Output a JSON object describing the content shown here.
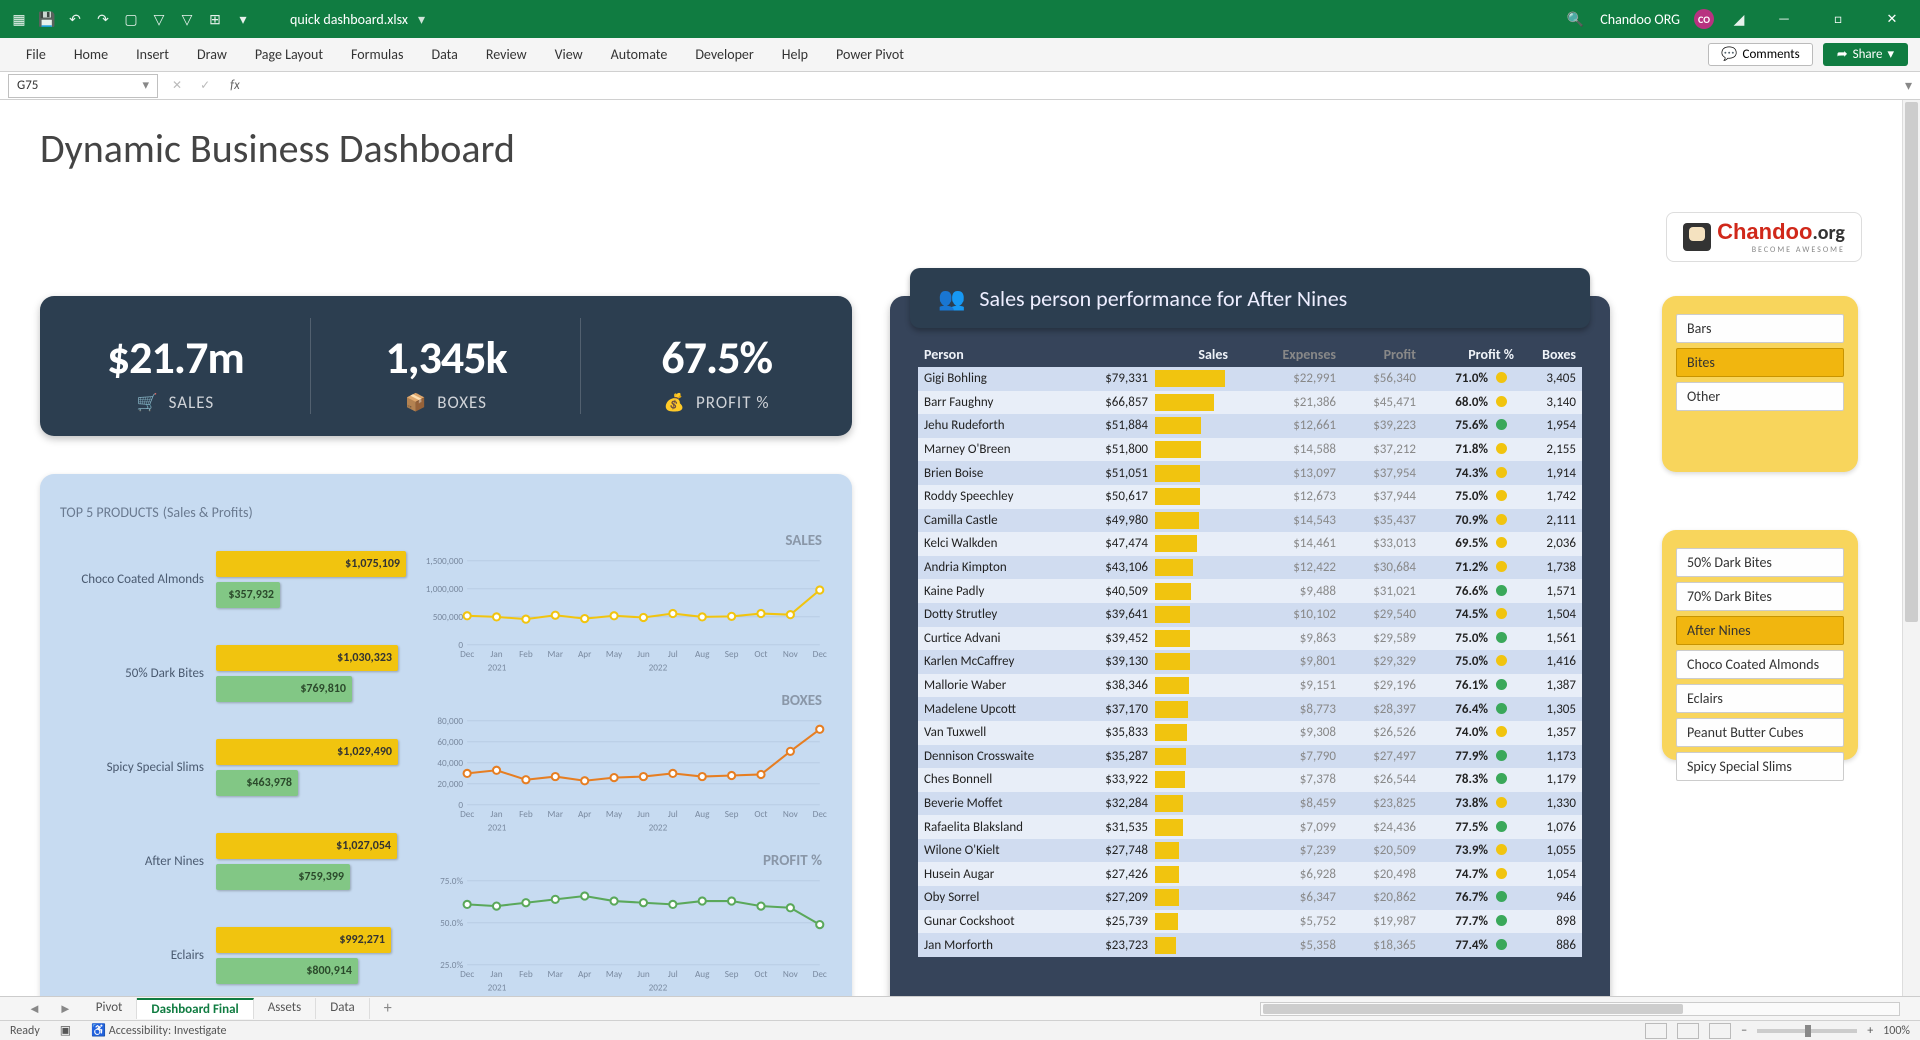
{
  "app": {
    "filename": "quick dashboard.xlsx",
    "user": "Chandoo ORG",
    "user_initials": "CO",
    "ribbon_tabs": [
      "File",
      "Home",
      "Insert",
      "Draw",
      "Page Layout",
      "Formulas",
      "Data",
      "Review",
      "View",
      "Automate",
      "Developer",
      "Help",
      "Power Pivot"
    ],
    "comments_label": "Comments",
    "share_label": "Share",
    "namebox": "G75",
    "sheet_tabs": [
      "Pivot",
      "Dashboard Final",
      "Assets",
      "Data"
    ],
    "active_sheet": "Dashboard Final",
    "status_ready": "Ready",
    "status_access": "Accessibility: Investigate",
    "zoom": "100%"
  },
  "dashboard": {
    "title": "Dynamic Business Dashboard",
    "logo_main": "Chandoo",
    "logo_suffix": ".org",
    "logo_tag": "BECOME AWESOME",
    "kpis": {
      "sales": {
        "value": "$21.7m",
        "label": "SALES"
      },
      "boxes": {
        "value": "1,345k",
        "label": "BOXES"
      },
      "profit": {
        "value": "67.5%",
        "label": "PROFIT %"
      }
    },
    "top5": {
      "title": "TOP 5 PRODUCTS",
      "subtitle": "(Sales & Profits)",
      "mini_labels": {
        "sales": "SALES",
        "boxes": "BOXES",
        "profit": "PROFIT %"
      },
      "products": [
        {
          "name": "Choco Coated Almonds",
          "sales": "$1,075,109",
          "profit": "$357,932",
          "sw": 190,
          "pw": 64
        },
        {
          "name": "50% Dark Bites",
          "sales": "$1,030,323",
          "profit": "$769,810",
          "sw": 182,
          "pw": 136
        },
        {
          "name": "Spicy Special Slims",
          "sales": "$1,029,490",
          "profit": "$463,978",
          "sw": 182,
          "pw": 82
        },
        {
          "name": "After Nines",
          "sales": "$1,027,054",
          "profit": "$759,399",
          "sw": 181,
          "pw": 134
        },
        {
          "name": "Eclairs",
          "sales": "$992,271",
          "profit": "$800,914",
          "sw": 175,
          "pw": 142
        }
      ]
    },
    "people": {
      "header_prefix": "Sales person performance for ",
      "header_product": "After Nines",
      "cols": [
        "Person",
        "Sales",
        "Expenses",
        "Profit",
        "Profit %",
        "Boxes"
      ],
      "rows": [
        {
          "p": "Gigi Bohling",
          "s": "$79,331",
          "e": "$22,991",
          "pr": "$56,340",
          "pc": "71.0%",
          "d": "y",
          "b": "3,405"
        },
        {
          "p": "Barr Faughny",
          "s": "$66,857",
          "e": "$21,386",
          "pr": "$45,471",
          "pc": "68.0%",
          "d": "y",
          "b": "3,140"
        },
        {
          "p": "Jehu Rudeforth",
          "s": "$51,884",
          "e": "$12,661",
          "pr": "$39,223",
          "pc": "75.6%",
          "d": "g",
          "b": "1,954"
        },
        {
          "p": "Marney O'Breen",
          "s": "$51,800",
          "e": "$14,588",
          "pr": "$37,212",
          "pc": "71.8%",
          "d": "y",
          "b": "2,155"
        },
        {
          "p": "Brien Boise",
          "s": "$51,051",
          "e": "$13,097",
          "pr": "$37,954",
          "pc": "74.3%",
          "d": "y",
          "b": "1,914"
        },
        {
          "p": "Roddy Speechley",
          "s": "$50,617",
          "e": "$12,673",
          "pr": "$37,944",
          "pc": "75.0%",
          "d": "y",
          "b": "1,742"
        },
        {
          "p": "Camilla Castle",
          "s": "$49,980",
          "e": "$14,543",
          "pr": "$35,437",
          "pc": "70.9%",
          "d": "y",
          "b": "2,111"
        },
        {
          "p": "Kelci Walkden",
          "s": "$47,474",
          "e": "$14,461",
          "pr": "$33,013",
          "pc": "69.5%",
          "d": "y",
          "b": "2,036"
        },
        {
          "p": "Andria Kimpton",
          "s": "$43,106",
          "e": "$12,422",
          "pr": "$30,684",
          "pc": "71.2%",
          "d": "y",
          "b": "1,738"
        },
        {
          "p": "Kaine Padly",
          "s": "$40,509",
          "e": "$9,488",
          "pr": "$31,021",
          "pc": "76.6%",
          "d": "g",
          "b": "1,571"
        },
        {
          "p": "Dotty Strutley",
          "s": "$39,641",
          "e": "$10,102",
          "pr": "$29,540",
          "pc": "74.5%",
          "d": "y",
          "b": "1,504"
        },
        {
          "p": "Curtice Advani",
          "s": "$39,452",
          "e": "$9,863",
          "pr": "$29,589",
          "pc": "75.0%",
          "d": "g",
          "b": "1,561"
        },
        {
          "p": "Karlen McCaffrey",
          "s": "$39,130",
          "e": "$9,801",
          "pr": "$29,329",
          "pc": "75.0%",
          "d": "y",
          "b": "1,416"
        },
        {
          "p": "Mallorie Waber",
          "s": "$38,346",
          "e": "$9,151",
          "pr": "$29,196",
          "pc": "76.1%",
          "d": "g",
          "b": "1,387"
        },
        {
          "p": "Madelene Upcott",
          "s": "$37,170",
          "e": "$8,773",
          "pr": "$28,397",
          "pc": "76.4%",
          "d": "g",
          "b": "1,305"
        },
        {
          "p": "Van Tuxwell",
          "s": "$35,833",
          "e": "$9,308",
          "pr": "$26,526",
          "pc": "74.0%",
          "d": "y",
          "b": "1,357"
        },
        {
          "p": "Dennison Crosswaite",
          "s": "$35,287",
          "e": "$7,790",
          "pr": "$27,497",
          "pc": "77.9%",
          "d": "g",
          "b": "1,173"
        },
        {
          "p": "Ches Bonnell",
          "s": "$33,922",
          "e": "$7,378",
          "pr": "$26,544",
          "pc": "78.3%",
          "d": "g",
          "b": "1,179"
        },
        {
          "p": "Beverie Moffet",
          "s": "$32,284",
          "e": "$8,459",
          "pr": "$23,825",
          "pc": "73.8%",
          "d": "y",
          "b": "1,330"
        },
        {
          "p": "Rafaelita Blaksland",
          "s": "$31,535",
          "e": "$7,099",
          "pr": "$24,436",
          "pc": "77.5%",
          "d": "g",
          "b": "1,076"
        },
        {
          "p": "Wilone O'Kielt",
          "s": "$27,748",
          "e": "$7,239",
          "pr": "$20,509",
          "pc": "73.9%",
          "d": "y",
          "b": "1,055"
        },
        {
          "p": "Husein Augar",
          "s": "$27,426",
          "e": "$6,928",
          "pr": "$20,498",
          "pc": "74.7%",
          "d": "y",
          "b": "1,054"
        },
        {
          "p": "Oby Sorrel",
          "s": "$27,209",
          "e": "$6,347",
          "pr": "$20,862",
          "pc": "76.7%",
          "d": "g",
          "b": "946"
        },
        {
          "p": "Gunar Cockshoot",
          "s": "$25,739",
          "e": "$5,752",
          "pr": "$19,987",
          "pc": "77.7%",
          "d": "g",
          "b": "898"
        },
        {
          "p": "Jan Morforth",
          "s": "$23,723",
          "e": "$5,358",
          "pr": "$18,365",
          "pc": "77.4%",
          "d": "g",
          "b": "886"
        }
      ],
      "max_s": 79331
    },
    "slicers": {
      "categories": [
        {
          "label": "Bars",
          "sel": false
        },
        {
          "label": "Bites",
          "sel": true
        },
        {
          "label": "Other",
          "sel": false
        }
      ],
      "products": [
        {
          "label": "50% Dark Bites",
          "sel": false
        },
        {
          "label": "70% Dark Bites",
          "sel": false
        },
        {
          "label": "After Nines",
          "sel": true
        },
        {
          "label": "Choco Coated Almonds",
          "sel": false
        },
        {
          "label": "Eclairs",
          "sel": false
        },
        {
          "label": "Peanut Butter Cubes",
          "sel": false
        },
        {
          "label": "Spicy Special Slims",
          "sel": false
        }
      ]
    }
  },
  "chart_data": [
    {
      "type": "bar",
      "title": "TOP 5 PRODUCTS (Sales & Profits)",
      "orientation": "horizontal",
      "categories": [
        "Choco Coated Almonds",
        "50% Dark Bites",
        "Spicy Special Slims",
        "After Nines",
        "Eclairs"
      ],
      "series": [
        {
          "name": "Sales",
          "values": [
            1075109,
            1030323,
            1029490,
            1027054,
            992271
          ],
          "color": "#f1c40f"
        },
        {
          "name": "Profit",
          "values": [
            357932,
            769810,
            463978,
            759399,
            800914
          ],
          "color": "#82c785"
        }
      ]
    },
    {
      "type": "line",
      "title": "SALES",
      "x": [
        "Dec",
        "Jan",
        "Feb",
        "Mar",
        "Apr",
        "May",
        "Jun",
        "Jul",
        "Aug",
        "Sep",
        "Oct",
        "Nov",
        "Dec"
      ],
      "x_years": [
        "2021",
        "2022"
      ],
      "ylim": [
        0,
        1500000
      ],
      "yticks": [
        0,
        500000,
        1000000,
        1500000
      ],
      "values": [
        520000,
        500000,
        460000,
        530000,
        470000,
        520000,
        490000,
        560000,
        500000,
        510000,
        560000,
        540000,
        980000
      ],
      "color": "#f1c40f"
    },
    {
      "type": "line",
      "title": "BOXES",
      "x": [
        "Dec",
        "Jan",
        "Feb",
        "Mar",
        "Apr",
        "May",
        "Jun",
        "Jul",
        "Aug",
        "Sep",
        "Oct",
        "Nov",
        "Dec"
      ],
      "x_years": [
        "2021",
        "2022"
      ],
      "ylim": [
        0,
        80000
      ],
      "yticks": [
        0,
        20000,
        40000,
        60000,
        80000
      ],
      "values": [
        30000,
        33000,
        24000,
        27000,
        23000,
        26000,
        27000,
        30000,
        27000,
        28000,
        29000,
        51000,
        72000
      ],
      "color": "#e67e22"
    },
    {
      "type": "line",
      "title": "PROFIT %",
      "x": [
        "Dec",
        "Jan",
        "Feb",
        "Mar",
        "Apr",
        "May",
        "Jun",
        "Jul",
        "Aug",
        "Sep",
        "Oct",
        "Nov",
        "Dec"
      ],
      "x_years": [
        "2021",
        "2022"
      ],
      "ylim": [
        0.25,
        0.75
      ],
      "yticks": [
        0.25,
        0.5,
        0.75
      ],
      "values": [
        0.61,
        0.6,
        0.62,
        0.64,
        0.66,
        0.63,
        0.62,
        0.61,
        0.63,
        0.63,
        0.6,
        0.59,
        0.49
      ],
      "color": "#5aa85a"
    }
  ]
}
